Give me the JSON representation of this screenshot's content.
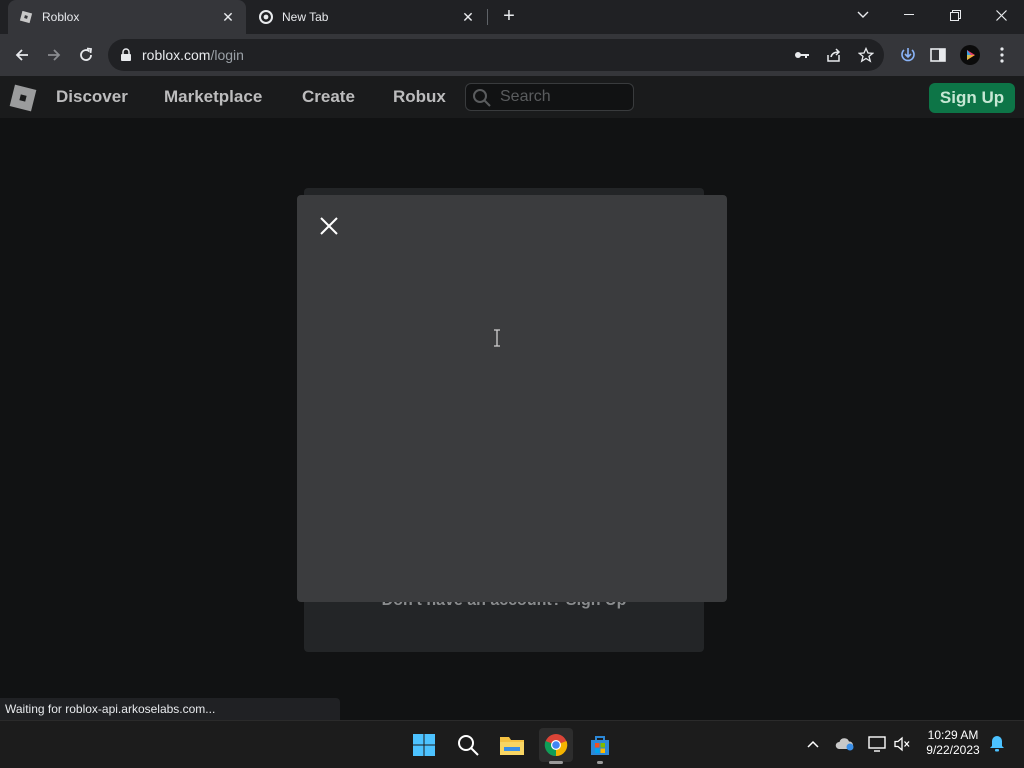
{
  "browser": {
    "tabs": [
      {
        "title": "Roblox",
        "active": true,
        "icon": "roblox-icon"
      },
      {
        "title": "New Tab",
        "active": false,
        "icon": "chrome-icon"
      }
    ],
    "url_host": "roblox.com",
    "url_path": "/login"
  },
  "nav": {
    "links": [
      "Discover",
      "Marketplace",
      "Create",
      "Robux"
    ],
    "search_placeholder": "Search",
    "signup_label": "Sign Up"
  },
  "page": {
    "below_modal_text": "Don't have an account? Sign Up"
  },
  "status_bar": "Waiting for roblox-api.arkoselabs.com...",
  "taskbar": {
    "time": "10:29 AM",
    "date": "9/22/2023"
  },
  "colors": {
    "brand_green": "#0d7547",
    "modal_bg": "#3b3c3e",
    "page_bg": "#111213"
  }
}
